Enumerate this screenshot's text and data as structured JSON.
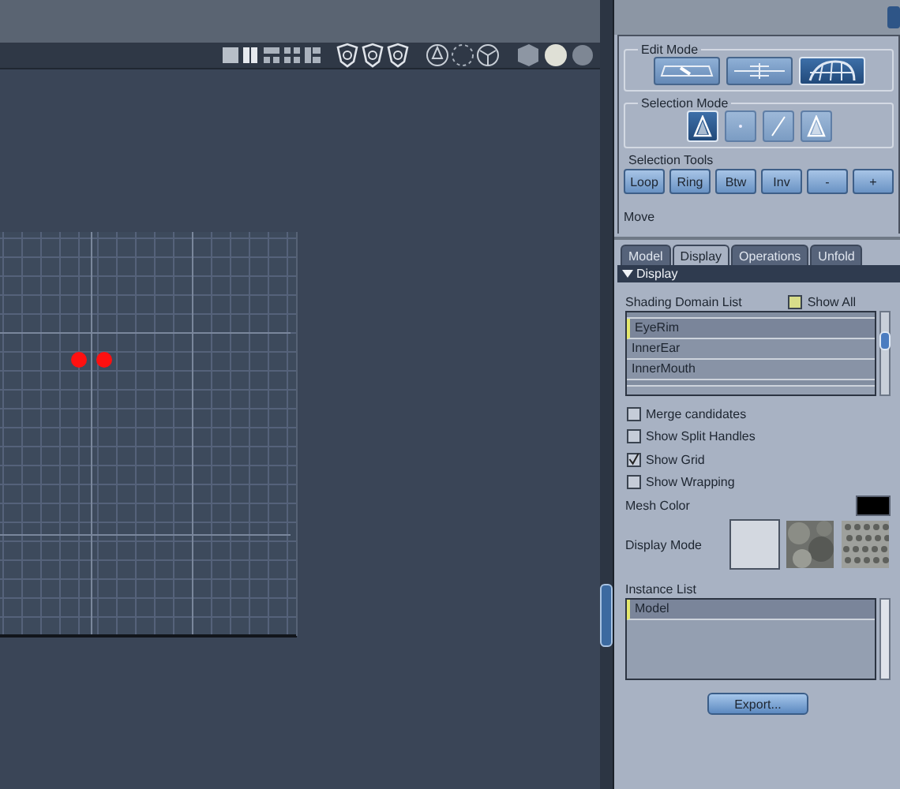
{
  "edit_mode": {
    "label": "Edit Mode",
    "buttons": [
      {
        "kind": "tool",
        "selected": false
      },
      {
        "kind": "symmetry",
        "selected": false
      },
      {
        "kind": "mesh",
        "selected": true
      }
    ]
  },
  "selection_mode": {
    "label": "Selection Mode",
    "buttons": [
      {
        "kind": "face",
        "selected": true
      },
      {
        "kind": "vertex",
        "selected": false
      },
      {
        "kind": "edge",
        "selected": false
      },
      {
        "kind": "face",
        "selected": false
      }
    ]
  },
  "selection_tools": {
    "label": "Selection Tools",
    "buttons": [
      "Loop",
      "Ring",
      "Btw",
      "Inv",
      "-",
      "+"
    ]
  },
  "move_label": "Move",
  "tabs": [
    {
      "label": "Model",
      "selected": false
    },
    {
      "label": "Display",
      "selected": true
    },
    {
      "label": "Operations",
      "selected": false
    },
    {
      "label": "Unfold",
      "selected": false
    }
  ],
  "section": {
    "label": "Display",
    "expanded": true
  },
  "shading_domain": {
    "label": "Shading Domain List",
    "show_all": {
      "label": "Show All",
      "checked": false
    },
    "items": [
      {
        "label": "EyeRim",
        "selected": true
      },
      {
        "label": "InnerEar",
        "selected": false
      },
      {
        "label": "InnerMouth",
        "selected": false
      }
    ]
  },
  "options": [
    {
      "label": "Merge candidates",
      "checked": false
    },
    {
      "label": "Show Split Handles",
      "checked": false
    },
    {
      "label": "Show Grid",
      "checked": true
    },
    {
      "label": "Show Wrapping",
      "checked": false
    }
  ],
  "mesh_color": {
    "label": "Mesh Color",
    "color": "#000000"
  },
  "display_mode": {
    "label": "Display Mode",
    "options": [
      {
        "kind": "flat",
        "selected": true
      },
      {
        "kind": "smooth",
        "selected": false
      },
      {
        "kind": "noisy",
        "selected": false
      }
    ]
  },
  "instance_list": {
    "label": "Instance List",
    "items": [
      {
        "label": "Model",
        "selected": true
      }
    ]
  },
  "export_button": "Export..."
}
